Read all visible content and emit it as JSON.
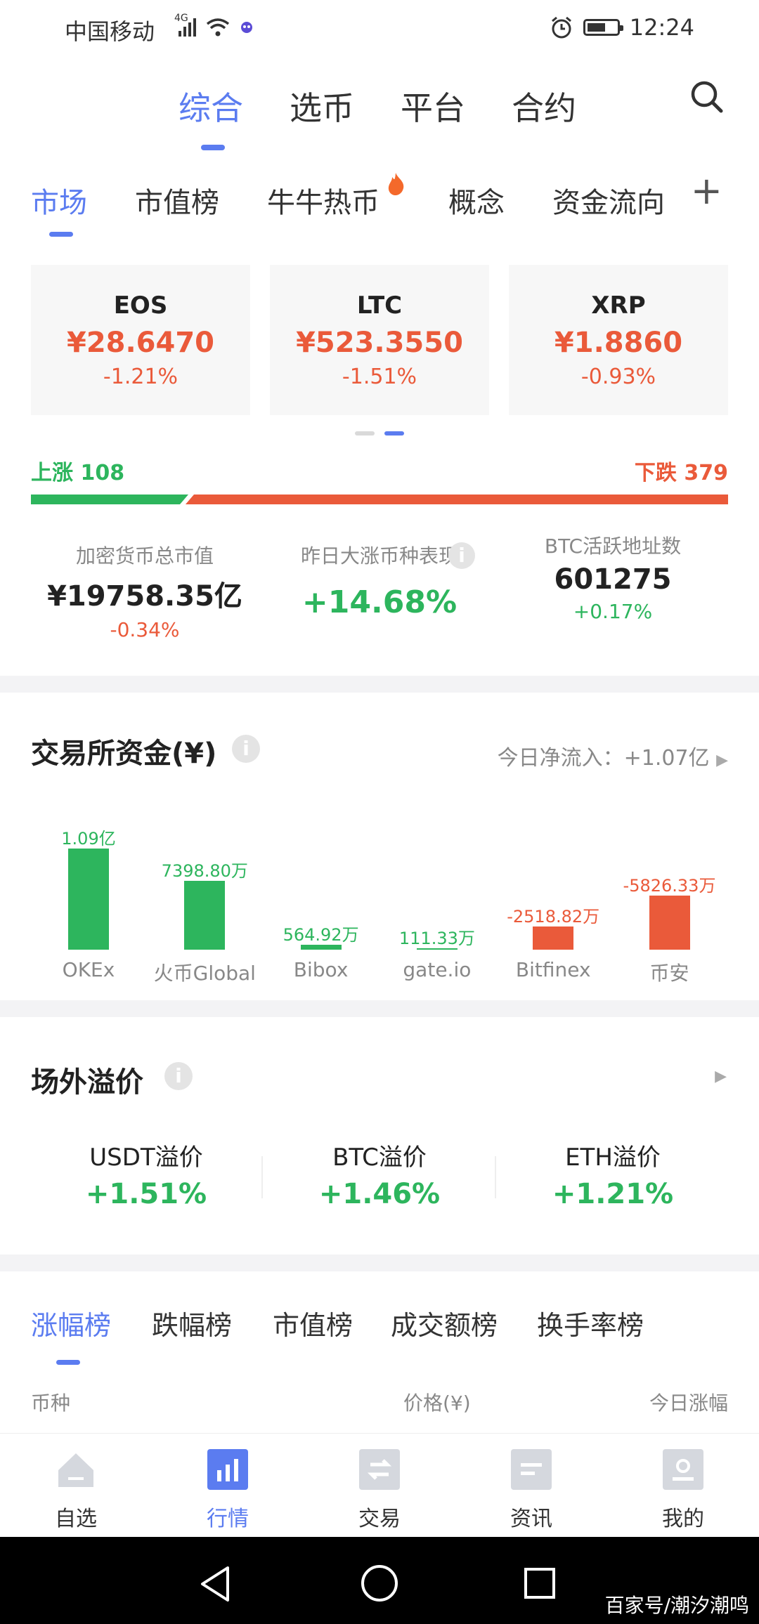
{
  "status": {
    "carrier": "中国移动",
    "network": "4G",
    "time": "12:24"
  },
  "top_tabs": [
    "综合",
    "选币",
    "平台",
    "合约"
  ],
  "sub_tabs": [
    "市场",
    "市值榜",
    "牛牛热币",
    "概念",
    "资金流向"
  ],
  "coins": [
    {
      "symbol": "EOS",
      "price": "¥28.6470",
      "change": "-1.21%"
    },
    {
      "symbol": "LTC",
      "price": "¥523.3550",
      "change": "-1.51%"
    },
    {
      "symbol": "XRP",
      "price": "¥1.8860",
      "change": "-0.93%"
    }
  ],
  "market_breadth": {
    "up_label": "上涨 108",
    "down_label": "下跌 379",
    "up": 108,
    "down": 379
  },
  "stats": {
    "total_cap_label": "加密货币总市值",
    "total_cap_value": "¥19758.35亿",
    "total_cap_change": "-0.34%",
    "top_gainer_label": "昨日大涨币种表现",
    "top_gainer_value": "+14.68%",
    "btc_addr_label": "BTC活跃地址数",
    "btc_addr_value": "601275",
    "btc_addr_change": "+0.17%"
  },
  "exchange_funds": {
    "title": "交易所资金(¥)",
    "net_inflow": "今日净流入：+1.07亿",
    "items": [
      {
        "name": "OKEx",
        "label": "1.09亿",
        "value": 10900
      },
      {
        "name": "火币Global",
        "label": "7398.80万",
        "value": 7398.8
      },
      {
        "name": "Bibox",
        "label": "564.92万",
        "value": 564.92
      },
      {
        "name": "gate.io",
        "label": "111.33万",
        "value": 111.33
      },
      {
        "name": "Bitfinex",
        "label": "-2518.82万",
        "value": -2518.82
      },
      {
        "name": "币安",
        "label": "-5826.33万",
        "value": -5826.33
      }
    ]
  },
  "otc_premium": {
    "title": "场外溢价",
    "items": [
      {
        "label": "USDT溢价",
        "value": "+1.51%"
      },
      {
        "label": "BTC溢价",
        "value": "+1.46%"
      },
      {
        "label": "ETH溢价",
        "value": "+1.21%"
      }
    ]
  },
  "rank_tabs": [
    "涨幅榜",
    "跌幅榜",
    "市值榜",
    "成交额榜",
    "换手率榜"
  ],
  "rank_columns": {
    "coin": "币种",
    "price": "价格(¥)",
    "change": "今日涨幅"
  },
  "bottom_nav": [
    "自选",
    "行情",
    "交易",
    "资讯",
    "我的"
  ],
  "watermark": "百家号/潮汐潮鸣",
  "colors": {
    "accent": "#5b7cf0",
    "up": "#2db55d",
    "down": "#ea5a3a"
  }
}
